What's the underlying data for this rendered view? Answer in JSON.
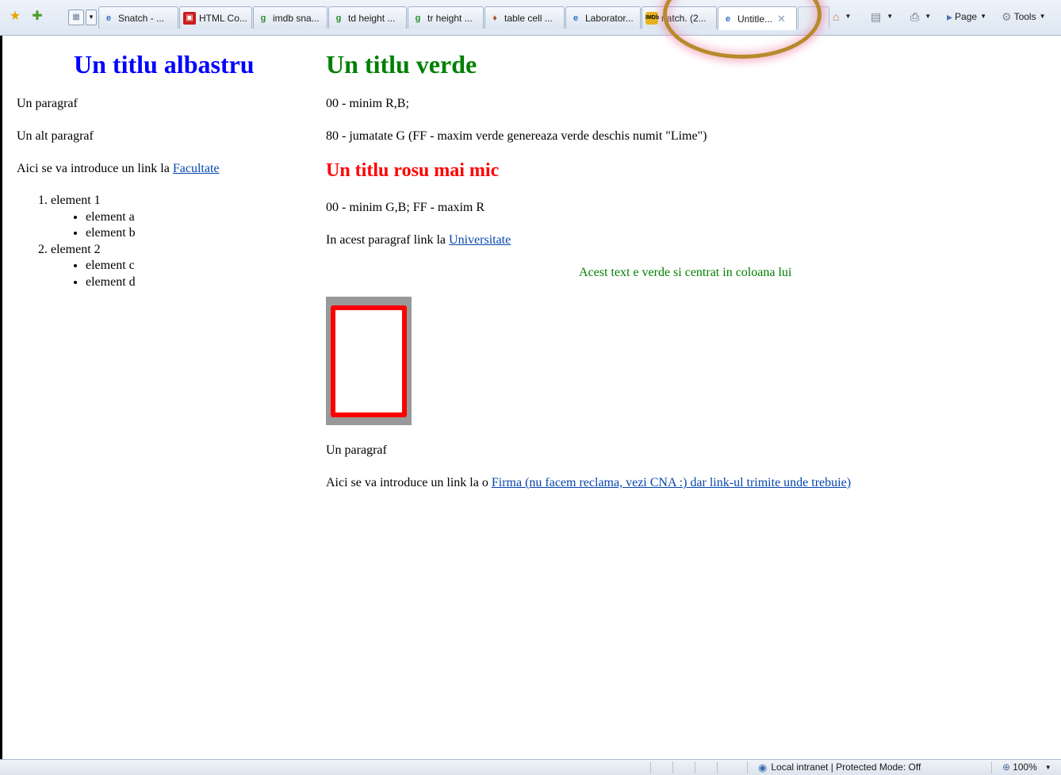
{
  "browser": {
    "tabs": [
      {
        "label": "Snatch - ...",
        "icon": "ie-page-icon"
      },
      {
        "label": "HTML Co...",
        "icon": "red-square-icon"
      },
      {
        "label": "imdb sna...",
        "icon": "google-icon"
      },
      {
        "label": "td height ...",
        "icon": "google-icon"
      },
      {
        "label": "tr height ...",
        "icon": "google-icon"
      },
      {
        "label": "table cell ...",
        "icon": "msdn-icon"
      },
      {
        "label": "Laborator...",
        "icon": "ie-page-icon"
      },
      {
        "label": "natch. (2...",
        "icon": "imdb-icon"
      },
      {
        "label": "Untitle...",
        "icon": "ie-page-icon",
        "active": true
      }
    ],
    "commands": {
      "page_label": "Page",
      "tools_label": "Tools"
    },
    "status": {
      "zone": "Local intranet | Protected Mode: Off",
      "zoom": "100%"
    }
  },
  "page": {
    "left": {
      "title": "Un titlu albastru",
      "para1": "Un paragraf",
      "para2": "Un alt paragraf",
      "link_para_prefix": "Aici se va introduce un link la ",
      "link_label": "Facultate",
      "list": {
        "item1": "element 1",
        "item1_sub": [
          "element a",
          "element b"
        ],
        "item2": "element 2",
        "item2_sub": [
          "element c",
          "element d"
        ]
      }
    },
    "right": {
      "title": "Un titlu verde",
      "para1": "00 - minim R,B;",
      "para2": "80 - jumatate G (FF - maxim verde genereaza verde deschis numit \"Lime\")",
      "subtitle": "Un titlu rosu mai mic",
      "para3": "00 - minim G,B; FF - maxim R",
      "link_para_prefix": "In acest paragraf link la ",
      "link_label": "Universitate",
      "centered_text": "Acest text e verde si centrat in coloana lui",
      "para4": "Un paragraf",
      "link2_para_prefix": "Aici se va introduce un link la o ",
      "link2_label": "Firma (nu facem reclama, vezi CNA :) dar link-ul trimite unde trebuie)"
    }
  },
  "colors": {
    "blue_title": "#0000ff",
    "green_title": "#008000",
    "red_title": "#ff0000",
    "image_frame": "#999999",
    "image_border": "#ff0000",
    "highlight_ring": "#b78a2a"
  }
}
